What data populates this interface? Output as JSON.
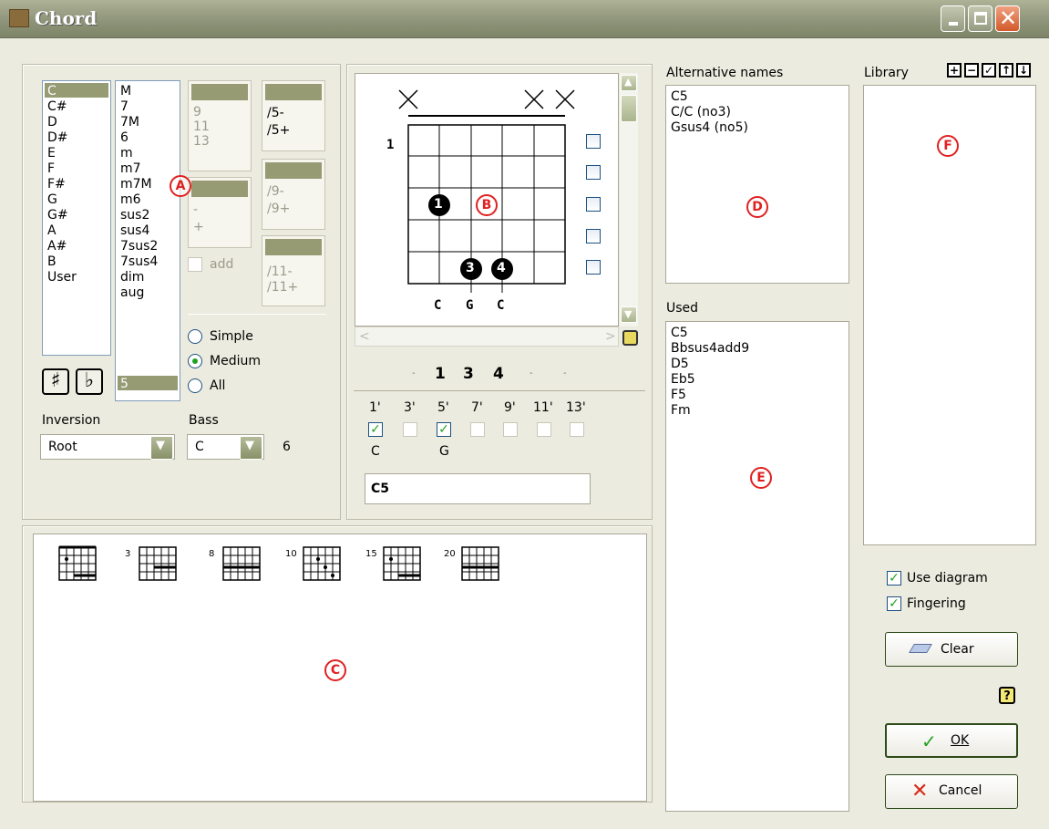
{
  "window": {
    "title": "Chord"
  },
  "roots": [
    "C",
    "C#",
    "D",
    "D#",
    "E",
    "F",
    "F#",
    "G",
    "G#",
    "A",
    "A#",
    "B",
    "User"
  ],
  "types": [
    "M",
    "7",
    "7M",
    "6",
    "m",
    "m7",
    "m7M",
    "m6",
    "sus2",
    "sus4",
    "7sus2",
    "7sus4",
    "dim",
    "aug",
    "5"
  ],
  "ext1": [
    "9",
    "11",
    "13"
  ],
  "ext2": [
    "-",
    "+"
  ],
  "ext3": [
    "/5-",
    "/5+"
  ],
  "ext4": [
    "/9-",
    "/9+"
  ],
  "ext5": [
    "/11-",
    "/11+"
  ],
  "add_label": "add",
  "mode_options": [
    "Simple",
    "Medium",
    "All"
  ],
  "inversion": {
    "label": "Inversion",
    "value": "Root"
  },
  "bass": {
    "label": "Bass",
    "value": "C"
  },
  "count_value": "6",
  "diagram": {
    "fret_number": "1",
    "muted": [
      "×",
      "×",
      "×"
    ],
    "dots": [
      "1",
      "3",
      "4"
    ],
    "notes": [
      "C",
      "G",
      "C"
    ],
    "fingering": [
      "-",
      "1",
      "3",
      "4",
      "-",
      "-"
    ]
  },
  "intervals": {
    "labels": [
      "1'",
      "3'",
      "5'",
      "7'",
      "9'",
      "11'",
      "13'"
    ],
    "notes": [
      "C",
      "G"
    ]
  },
  "chord_name": "C5",
  "alt_names": {
    "label": "Alternative names",
    "items": [
      "C5",
      "C/C (no3)",
      "Gsus4 (no5)"
    ]
  },
  "used": {
    "label": "Used",
    "items": [
      "C5",
      "Bbsus4add9",
      "D5",
      "Eb5",
      "F5",
      "Fm"
    ]
  },
  "library": {
    "label": "Library",
    "tools": [
      "+",
      "−",
      "✓",
      "↑",
      "↓"
    ]
  },
  "variant_frets": [
    "",
    "3",
    "8",
    "10",
    "15",
    "20"
  ],
  "options": {
    "use_diagram": "Use diagram",
    "fingering": "Fingering"
  },
  "buttons": {
    "clear": "Clear",
    "ok": "OK",
    "cancel": "Cancel",
    "help": "?"
  },
  "markers": [
    "A",
    "B",
    "C",
    "D",
    "E",
    "F"
  ],
  "sharp_flat": [
    "♯",
    "♭"
  ]
}
